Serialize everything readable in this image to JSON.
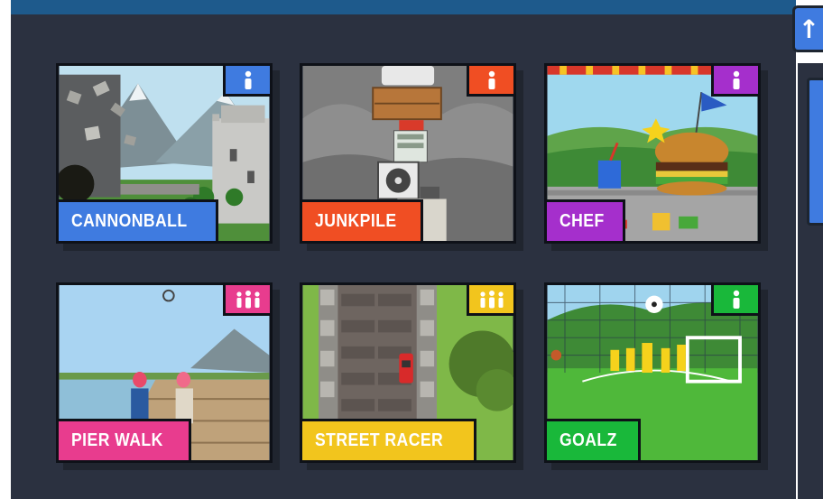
{
  "scroll_up_button": {
    "icon": "arrow-up-icon",
    "glyph": "↑"
  },
  "games": [
    {
      "title": "CANNONBALL",
      "players": "single-player-icon",
      "color": "#3f7be0"
    },
    {
      "title": "JUNKPILE",
      "players": "single-player-icon",
      "color": "#f04e23"
    },
    {
      "title": "CHEF",
      "players": "single-player-icon",
      "color": "#a52fcc"
    },
    {
      "title": "PIER WALK",
      "players": "multi-player-icon",
      "color": "#e83c8e"
    },
    {
      "title": "STREET RACER",
      "players": "multi-player-icon",
      "color": "#f2c51d"
    },
    {
      "title": "GOALZ",
      "players": "single-player-icon",
      "color": "#19b83a"
    }
  ]
}
